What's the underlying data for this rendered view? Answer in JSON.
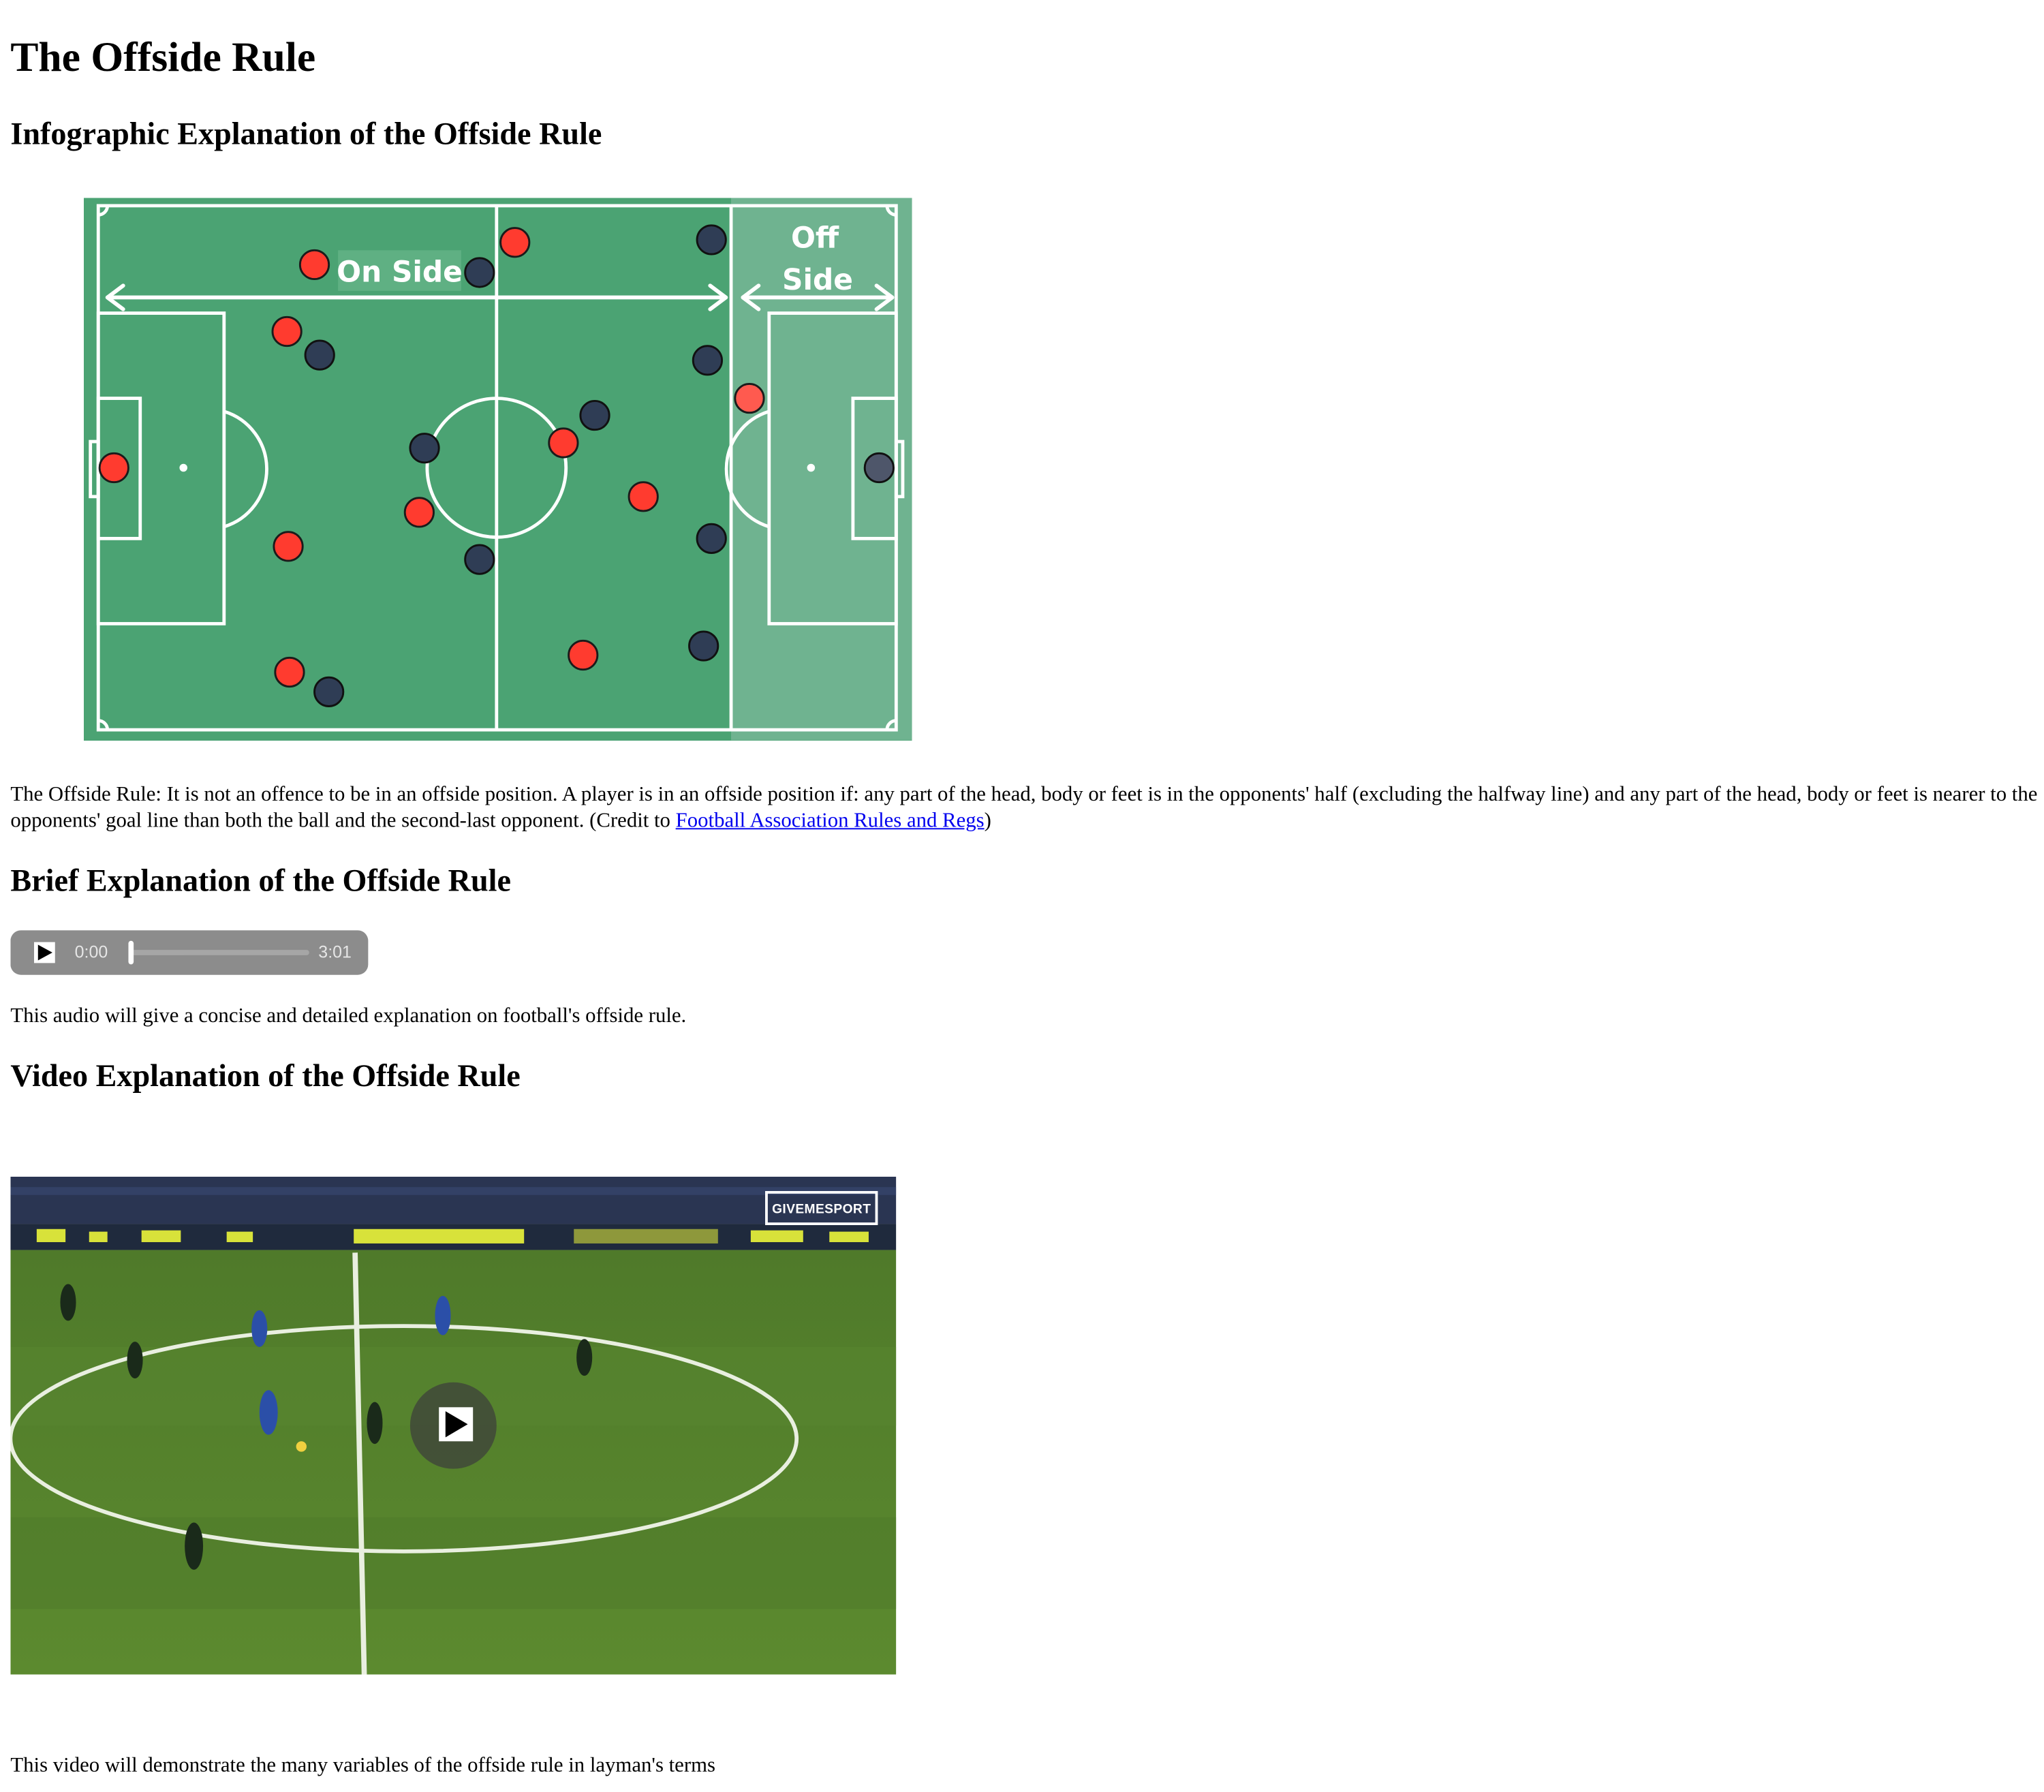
{
  "page": {
    "title": "The Offside Rule"
  },
  "infographic": {
    "heading": "Infographic Explanation of the Offside Rule",
    "onside_label": "On Side",
    "offside_label_1": "Off",
    "offside_label_2": "Side",
    "colors": {
      "pitch": "#4ba373",
      "offside_zone": "#6fb390",
      "red_team": "#ff3b2f",
      "dark_team": "#2f3d55"
    }
  },
  "rule_text": {
    "body": "The Offside Rule: It is not an offence to be in an offside position. A player is in an offside position if: any part of the head, body or feet is in the opponents' half (excluding the halfway line) and any part of the head, body or feet is nearer to the opponents' goal line than both the ball and the second-last opponent. (Credit to ",
    "link": "Football Association Rules and Regs",
    "suffix": ")"
  },
  "audio_section": {
    "heading": "Brief Explanation of the Offside Rule",
    "current_time": "0:00",
    "duration": "3:01",
    "progress": 0,
    "caption": "This audio will give a concise and detailed explanation on football's offside rule."
  },
  "video_section": {
    "heading": "Video Explanation of the Offside Rule",
    "logo": "GIVEMESPORT",
    "caption": "This video will demonstrate the many variables of the offside rule in layman's terms"
  }
}
